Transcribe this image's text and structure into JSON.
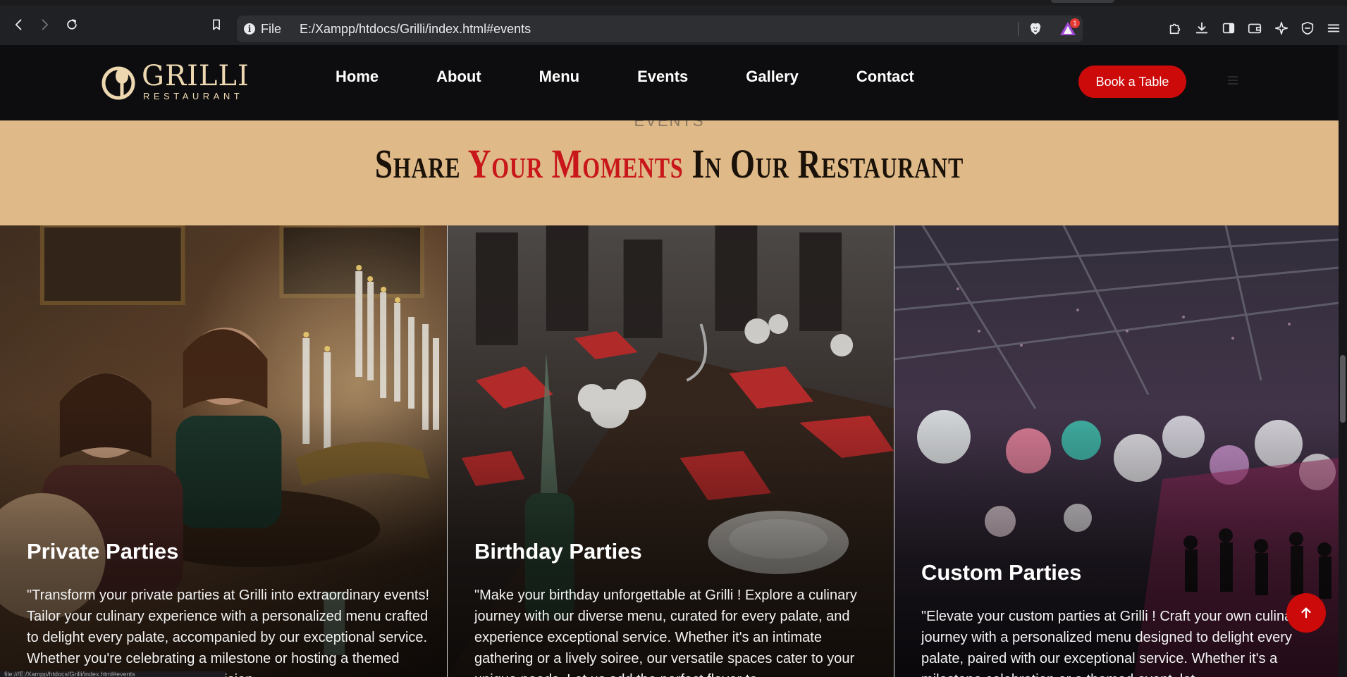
{
  "browser": {
    "site_info_label": "File",
    "url": "E:/Xampp/htdocs/Grilli/index.html#events",
    "rewards_badge": "1",
    "status_url": "file:///E:/Xampp/htdocs/Grilli/index.html#events"
  },
  "header": {
    "logo_name": "GRILLI",
    "logo_sub": "RESTAURANT",
    "nav": [
      "Home",
      "About",
      "Menu",
      "Events",
      "Gallery",
      "Contact"
    ],
    "cta": "Book a Table"
  },
  "events": {
    "kicker": "EVENTS",
    "title_pre": "Share ",
    "title_accent": "Your Moments",
    "title_post": " In Our Restaurant",
    "cards": [
      {
        "title": "Private Parties",
        "text": "\"Transform your private parties at Grilli into extraordinary events! Tailor your culinary experience with a personalized menu crafted to delight every palate, accompanied by our exceptional service. Whether you're celebrating a milestone or hosting a themed event, entrust us to bring your vision"
      },
      {
        "title": "Birthday Parties",
        "text": "\"Make your birthday unforgettable at Grilli ! Explore a culinary journey with our diverse menu, curated for every palate, and experience exceptional service. Whether it's an intimate gathering or a lively soiree, our versatile spaces cater to your unique needs. Let us add the perfect flavor to"
      },
      {
        "title": "Custom Parties",
        "text": "\"Elevate your custom parties at Grilli ! Craft your own culinary journey with a personalized menu designed to delight every palate, paired with our exceptional service. Whether it's a milestone celebration or a themed event, let"
      }
    ]
  },
  "colors": {
    "brand_red": "#cc0a0a",
    "band": "#dfb988",
    "logo_gold": "#ecd7b0"
  }
}
